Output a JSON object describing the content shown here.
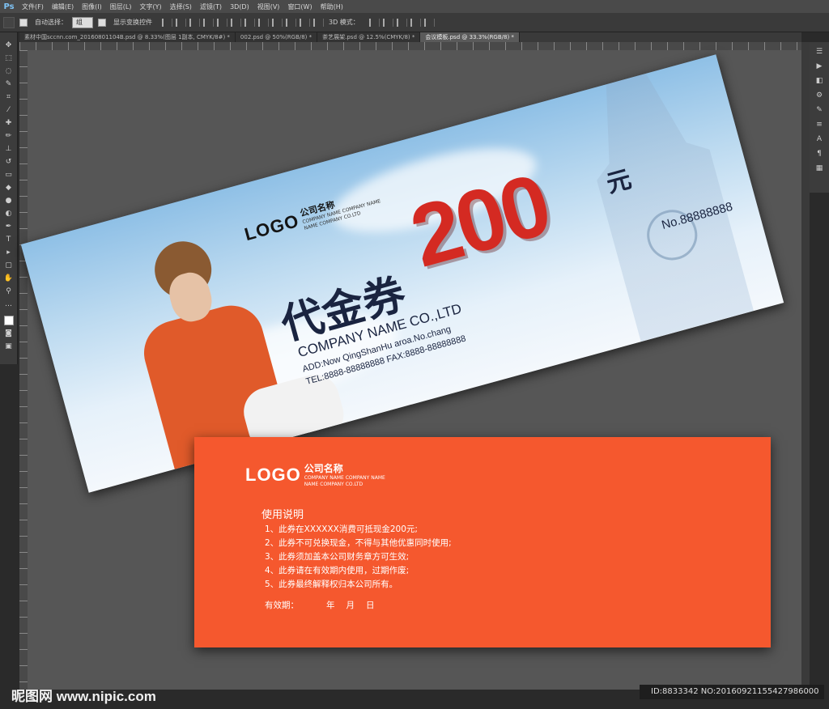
{
  "menubar": {
    "app_logo": "Ps",
    "items": [
      "文件(F)",
      "编辑(E)",
      "图像(I)",
      "图层(L)",
      "文字(Y)",
      "选择(S)",
      "滤镜(T)",
      "3D(D)",
      "视图(V)",
      "窗口(W)",
      "帮助(H)"
    ]
  },
  "optionsbar": {
    "auto_select_label": "自动选择：",
    "auto_select_value": "组",
    "show_transform_label": "显示变换控件",
    "mode_3d_label": "3D 模式："
  },
  "tabs": [
    {
      "label": "素材中国sccnn.com_20160801104B.psd @ 8.33%(图层 1副本, CMYK/8#) *"
    },
    {
      "label": "002.psd @ 50%(RGB/8) *"
    },
    {
      "label": "茶艺展架.psd @ 12.5%(CMYK/8) *"
    },
    {
      "label": "会议模板.psd @ 33.3%(RGB/8) *"
    }
  ],
  "voucher_front": {
    "logo": "LOGO",
    "company_cn": "公司名称",
    "company_en_line1": "COMPANY NAME COMPANY NAME",
    "company_en_line2": "NAME COMPANY CO.LTD",
    "title": "代金券",
    "amount": "200",
    "unit": "元",
    "number": "No.88888888",
    "company_name": "COMPANY NAME CO.,LTD",
    "address": "ADD:Now QingShanHu aroa.No.chang",
    "tel_fax": "TEL:8888-88888888  FAX:8888-88888888"
  },
  "voucher_back": {
    "logo": "LOGO",
    "company_cn": "公司名称",
    "company_en_line1": "COMPANY NAME COMPANY NAME",
    "company_en_line2": "NAME COMPANY CO.LTD",
    "instructions_title": "使用说明",
    "rules": [
      "1、此券在XXXXXX消费可抵现金200元;",
      "2、此券不可兑换现金，不得与其他优惠同时使用;",
      "3、此券须加盖本公司财务章方可生效;",
      "4、此券请在有效期内使用，过期作废;",
      "5、此券最终解释权归本公司所有。"
    ],
    "valid_label": "有效期：",
    "year": "年",
    "month": "月",
    "day": "日"
  },
  "footer": {
    "watermark": "昵图网 www.nipic.com",
    "id_text": "ID:8833342 NO:20160921155427986000"
  },
  "colors": {
    "voucher_red": "#d42a22",
    "back_orange": "#f5582e",
    "navy": "#1a2440"
  }
}
